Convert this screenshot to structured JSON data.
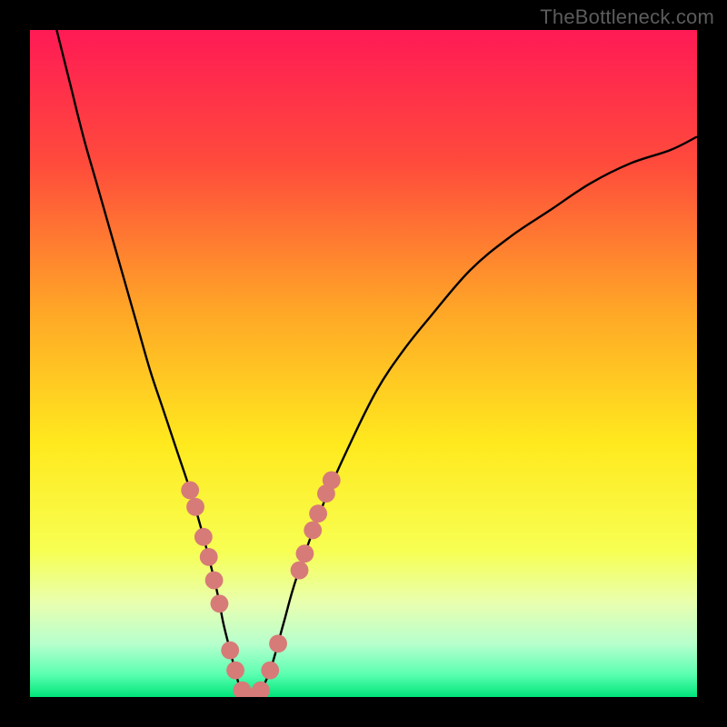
{
  "watermark": {
    "text": "TheBottleneck.com"
  },
  "chart_data": {
    "type": "line",
    "title": "",
    "xlabel": "",
    "ylabel": "",
    "xlim": [
      0,
      100
    ],
    "ylim": [
      0,
      100
    ],
    "grid": false,
    "gradient_stops": [
      {
        "offset": 0.0,
        "color": "#ff1a55"
      },
      {
        "offset": 0.2,
        "color": "#ff4b3c"
      },
      {
        "offset": 0.42,
        "color": "#ffa627"
      },
      {
        "offset": 0.62,
        "color": "#ffe91e"
      },
      {
        "offset": 0.78,
        "color": "#f7ff52"
      },
      {
        "offset": 0.86,
        "color": "#e8ffb0"
      },
      {
        "offset": 0.92,
        "color": "#b7ffcd"
      },
      {
        "offset": 0.965,
        "color": "#5dffb1"
      },
      {
        "offset": 1.0,
        "color": "#00e57a"
      }
    ],
    "series": [
      {
        "name": "bottleneck-curve",
        "color": "#000000",
        "x": [
          4,
          6,
          8,
          10,
          12,
          14,
          16,
          18,
          20,
          22,
          24,
          26,
          28,
          29,
          30,
          31,
          32,
          33,
          34,
          36,
          38,
          40,
          44,
          48,
          52,
          56,
          60,
          66,
          72,
          78,
          84,
          90,
          96,
          100
        ],
        "y": [
          100,
          92,
          84,
          77,
          70,
          63,
          56,
          49,
          43,
          37,
          31,
          24,
          16,
          11,
          7,
          3,
          0,
          0,
          0,
          4,
          11,
          18,
          29,
          38,
          46,
          52,
          57,
          64,
          69,
          73,
          77,
          80,
          82,
          84
        ]
      }
    ],
    "markers": {
      "color": "#d77b78",
      "radius_pct": 1.35,
      "points": [
        {
          "x": 24.0,
          "y": 31.0
        },
        {
          "x": 24.8,
          "y": 28.5
        },
        {
          "x": 26.0,
          "y": 24.0
        },
        {
          "x": 26.8,
          "y": 21.0
        },
        {
          "x": 27.6,
          "y": 17.5
        },
        {
          "x": 28.4,
          "y": 14.0
        },
        {
          "x": 30.0,
          "y": 7.0
        },
        {
          "x": 30.8,
          "y": 4.0
        },
        {
          "x": 31.8,
          "y": 1.0
        },
        {
          "x": 32.8,
          "y": 0.0
        },
        {
          "x": 33.6,
          "y": 0.0
        },
        {
          "x": 34.6,
          "y": 1.0
        },
        {
          "x": 36.0,
          "y": 4.0
        },
        {
          "x": 37.2,
          "y": 8.0
        },
        {
          "x": 40.4,
          "y": 19.0
        },
        {
          "x": 41.2,
          "y": 21.5
        },
        {
          "x": 42.4,
          "y": 25.0
        },
        {
          "x": 43.2,
          "y": 27.5
        },
        {
          "x": 44.4,
          "y": 30.5
        },
        {
          "x": 45.2,
          "y": 32.5
        }
      ]
    }
  }
}
